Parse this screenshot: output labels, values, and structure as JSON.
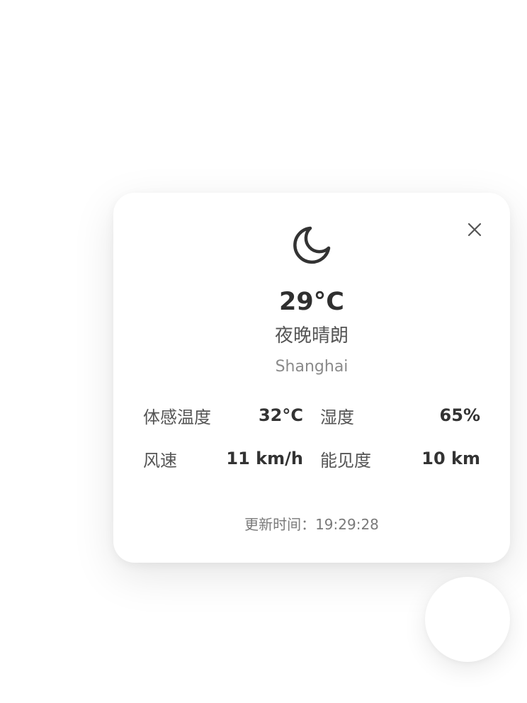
{
  "weather": {
    "icon": "moon-icon",
    "temperature": "29°C",
    "condition": "夜晚晴朗",
    "city": "Shanghai"
  },
  "details": {
    "feels_like": {
      "label": "体感温度",
      "value": "32°C"
    },
    "humidity": {
      "label": "湿度",
      "value": "65%"
    },
    "wind": {
      "label": "风速",
      "value": "11 km/h"
    },
    "visibility": {
      "label": "能见度",
      "value": "10 km"
    }
  },
  "footer": {
    "updated": "更新时间：19:29:28"
  },
  "colors": {
    "text_primary": "#2f2f2f",
    "text_secondary": "#555555",
    "text_muted": "#8a8a8a",
    "card_background": "#ffffff"
  }
}
